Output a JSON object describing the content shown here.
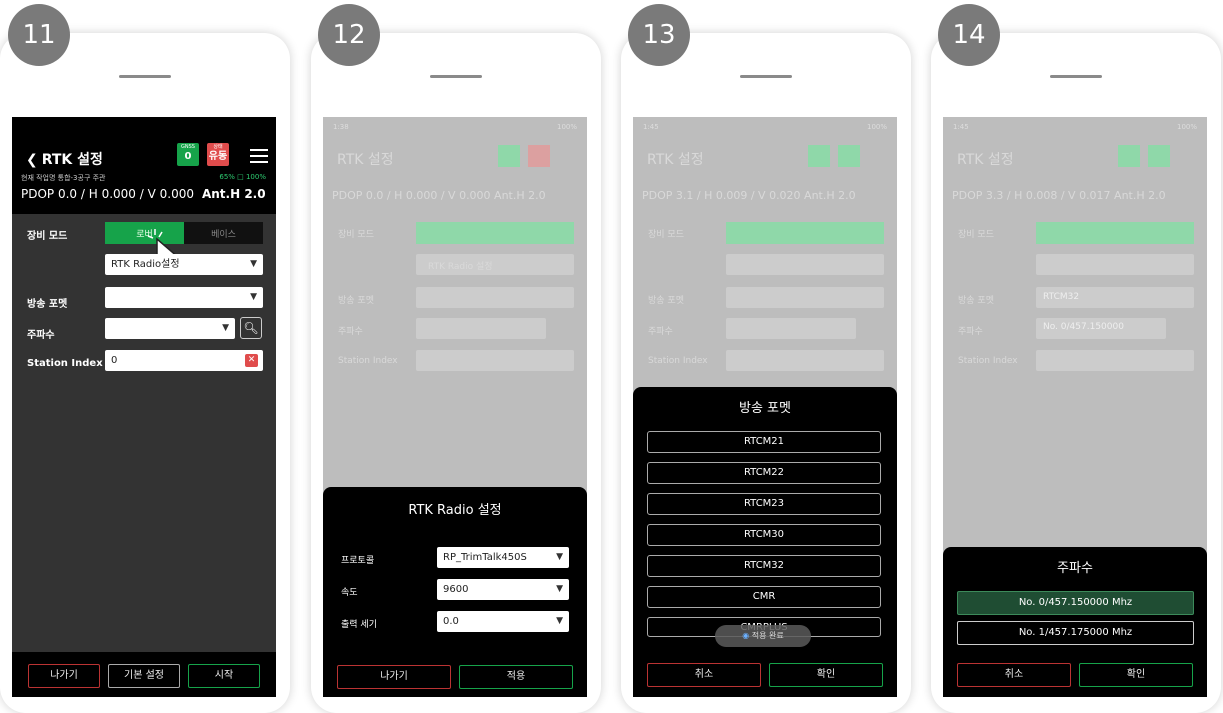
{
  "steps": [
    "11",
    "12",
    "13",
    "14"
  ],
  "colors": {
    "accent_green": "#16a34a",
    "alert_red": "#e04c4c",
    "screen_bg": "#333333"
  },
  "screen11": {
    "title": "RTK 설정",
    "back_icon": "chevron-left-icon",
    "badge1_label": "GNSS",
    "badge1_value": "0",
    "badge2_label": "상태",
    "badge2_value": "유동",
    "subtitle": "현재 작업명 통합-3공구 주관",
    "battery": "65%  □ 100%",
    "pdop": "PDOP 0.0 / H 0.000 / V 0.000",
    "ant_h": "Ant.H 2.0",
    "mode_label": "장비 모드",
    "mode_rover": "로버",
    "mode_base": "베이스",
    "radio_select": "RTK Radio설정",
    "format_label": "방송 포멧",
    "freq_label": "주파수",
    "station_label": "Station Index",
    "station_value": "0",
    "btn_exit": "나가기",
    "btn_default": "기본 설정",
    "btn_start": "시작"
  },
  "screen12": {
    "status_time": "1:38",
    "status_right": "100%",
    "sheet_title": "RTK Radio 설정",
    "protocol_label": "프로토콜",
    "protocol_value": "RP_TrimTalk450S",
    "speed_label": "속도",
    "speed_value": "9600",
    "power_label": "출력 세기",
    "power_value": "0.0",
    "btn_exit": "나가기",
    "btn_apply": "적용",
    "ghost_title": "RTK 설정",
    "ghost_pdop": "PDOP 0.0 / H 0.000 / V 0.000  Ant.H 2.0",
    "ghost_mode": "장비 모드",
    "ghost_radio": "RTK Radio 설정",
    "ghost_format": "방송 포멧",
    "ghost_freq": "주파수",
    "ghost_station": "Station Index"
  },
  "screen13": {
    "status_time": "1:45",
    "status_right": "100%",
    "sheet_title": "방송 포멧",
    "options": [
      "RTCM21",
      "RTCM22",
      "RTCM23",
      "RTCM30",
      "RTCM32",
      "CMR",
      "CMRPLUS"
    ],
    "toast": "적용 완료",
    "btn_cancel": "취소",
    "btn_ok": "확인",
    "ghost_pdop": "PDOP 3.1 / H 0.009 / V 0.020  Ant.H 2.0"
  },
  "screen14": {
    "status_time": "1:45",
    "status_right": "100%",
    "sheet_title": "주파수",
    "options": [
      "No. 0/457.150000 Mhz",
      "No. 1/457.175000 Mhz"
    ],
    "btn_cancel": "취소",
    "btn_ok": "확인",
    "ghost_pdop": "PDOP 3.3 / H 0.008 / V 0.017  Ant.H 2.0",
    "ghost_format": "RTCM32",
    "ghost_freq": "No. 0/457.150000"
  }
}
